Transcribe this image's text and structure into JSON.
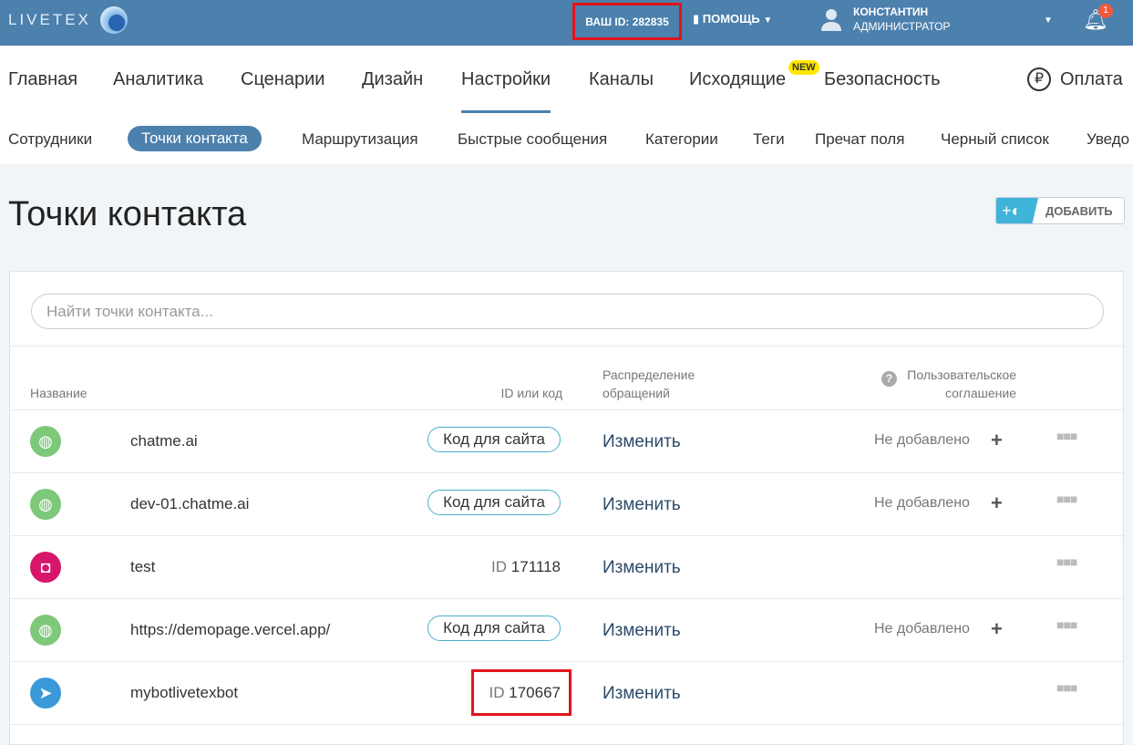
{
  "header": {
    "logo": "LIVETEX",
    "my_id": "ВАШ ID: 282835",
    "help": "ПОМОЩЬ",
    "user_name": "КОНСТАНТИН",
    "user_role": "АДМИНИСТРАТОР",
    "notifications": "1"
  },
  "nav": {
    "items": [
      "Главная",
      "Аналитика",
      "Сценарии",
      "Дизайн",
      "Настройки",
      "Каналы",
      "Исходящие",
      "Безопасность"
    ],
    "new_badge": "NEW",
    "payment": "Оплата",
    "active": "Настройки"
  },
  "subnav": {
    "items": [
      "Сотрудники",
      "Точки контакта",
      "Маршрутизация",
      "Быстрые сообщения",
      "Категории",
      "Теги",
      "Пречат поля",
      "Черный список",
      "Уведо"
    ],
    "active": "Точки контакта"
  },
  "page": {
    "title": "Точки контакта",
    "add_label": "ДОБАВИТЬ",
    "search_placeholder": "Найти точки контакта..."
  },
  "table": {
    "headers": {
      "name": "Название",
      "id": "ID или код",
      "dist1": "Распределение",
      "dist2": "обращений",
      "agree1": "Пользовательское",
      "agree2": "соглашение"
    },
    "rows": [
      {
        "icon": "globe-icon",
        "name": "chatme.ai",
        "code": "Код для сайта",
        "change": "Изменить",
        "agreement": "Не добавлено"
      },
      {
        "icon": "globe-icon",
        "name": "dev-01.chatme.ai",
        "code": "Код для сайта",
        "change": "Изменить",
        "agreement": "Не добавлено"
      },
      {
        "icon": "instagram-icon",
        "name": "test",
        "id_prefix": "ID",
        "id": "171118",
        "change": "Изменить"
      },
      {
        "icon": "globe-icon",
        "name": "https://demopage.vercel.app/",
        "code": "Код для сайта",
        "change": "Изменить",
        "agreement": "Не добавлено"
      },
      {
        "icon": "telegram-icon",
        "name": "mybotlivetexbot",
        "id_prefix": "ID",
        "id": "170667",
        "change": "Изменить"
      }
    ]
  },
  "colors": {
    "header": "#4c80ad",
    "globe": "#7ec87a",
    "instagram": "#d6156b",
    "telegram": "#3a9ad9",
    "highlight": "#e0141b"
  }
}
